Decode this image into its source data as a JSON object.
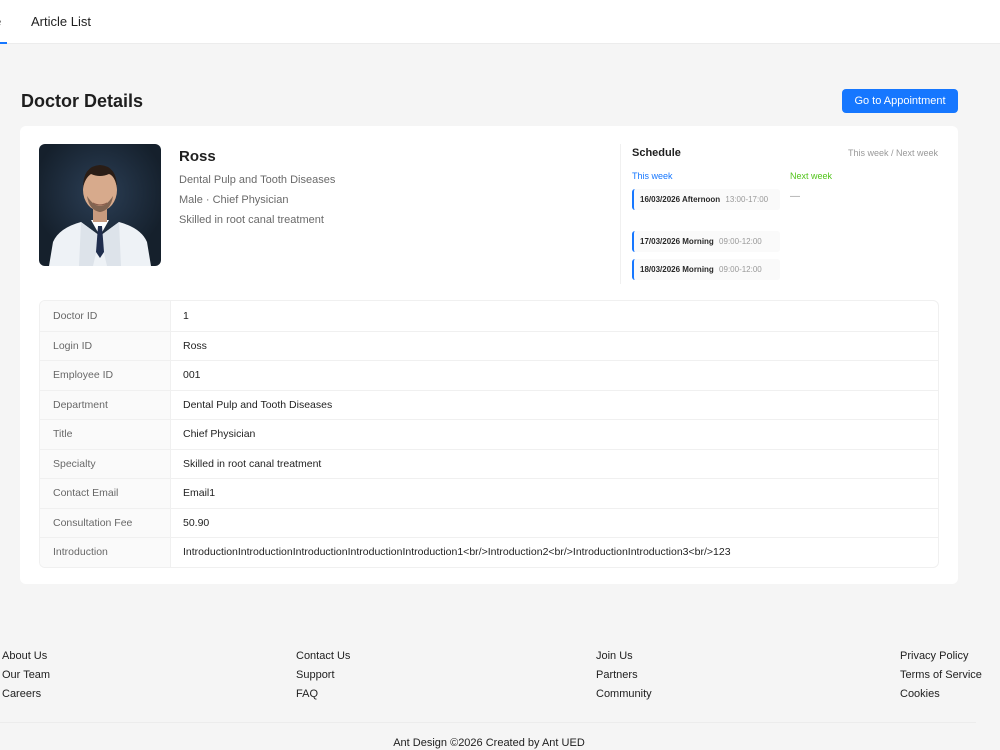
{
  "nav": {
    "home_label": "e",
    "articles_label": "Article List"
  },
  "page": {
    "title": "Doctor Details",
    "appointment_button": "Go to Appointment"
  },
  "doctor": {
    "name": "Ross",
    "department": "Dental Pulp and Tooth Diseases",
    "gender_title": "Male · Chief Physician",
    "specialty": "Skilled in root canal treatment"
  },
  "schedule": {
    "title": "Schedule",
    "toggle": "This week / Next week",
    "this_week_label": "This week",
    "next_week_label": "Next week",
    "next_week_empty": "—",
    "slots": [
      {
        "date": "16/03/2026 Afternoon",
        "time": "13:00-17:00"
      },
      {
        "date": "17/03/2026 Morning",
        "time": "09:00-12:00"
      },
      {
        "date": "18/03/2026 Morning",
        "time": "09:00-12:00"
      }
    ]
  },
  "details": [
    {
      "label": "Doctor ID",
      "value": "1"
    },
    {
      "label": "Login ID",
      "value": "Ross"
    },
    {
      "label": "Employee ID",
      "value": "001"
    },
    {
      "label": "Department",
      "value": "Dental Pulp and Tooth Diseases"
    },
    {
      "label": "Title",
      "value": "Chief Physician"
    },
    {
      "label": "Specialty",
      "value": "Skilled in root canal treatment"
    },
    {
      "label": "Contact Email",
      "value": "Email1"
    },
    {
      "label": "Consultation Fee",
      "value": "50.90"
    },
    {
      "label": "Introduction",
      "value": "IntroductionIntroductionIntroductionIntroductionIntroduction1<br/>Introduction2<br/>IntroductionIntroduction3<br/>123"
    }
  ],
  "footer": {
    "col1": [
      "About Us",
      "Our Team",
      "Careers"
    ],
    "col2": [
      "Contact Us",
      "Support",
      "FAQ"
    ],
    "col3": [
      "Join Us",
      "Partners",
      "Community"
    ],
    "col4": [
      "Privacy Policy",
      "Terms of Service",
      "Cookies"
    ],
    "copyright": "Ant Design ©2026 Created by Ant UED"
  },
  "colors": {
    "primary": "#1677ff",
    "success": "#52c41a",
    "background": "#f5f5f5"
  }
}
